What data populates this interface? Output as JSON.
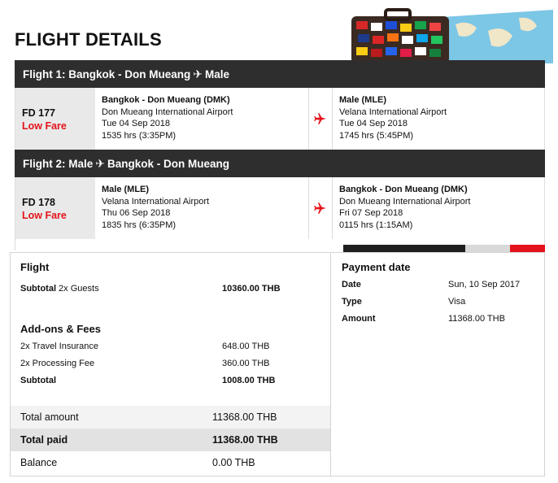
{
  "page": {
    "title": "FLIGHT DETAILS"
  },
  "flights": [
    {
      "header": {
        "from": "Flight 1: Bangkok - Don Mueang",
        "to": "Male"
      },
      "flight_no": "FD 177",
      "fare": "Low Fare",
      "departure": {
        "city": "Bangkok - Don Mueang (DMK)",
        "airport": "Don Mueang International Airport",
        "date": "Tue 04 Sep 2018",
        "time": "1535 hrs (3:35PM)"
      },
      "arrival": {
        "city": "Male (MLE)",
        "airport": "Velana International Airport",
        "date": "Tue 04 Sep 2018",
        "time": "1745 hrs (5:45PM)"
      }
    },
    {
      "header": {
        "from": "Flight 2: Male",
        "to": "Bangkok - Don Mueang"
      },
      "flight_no": "FD 178",
      "fare": "Low Fare",
      "departure": {
        "city": "Male (MLE)",
        "airport": "Velana International Airport",
        "date": "Thu 06 Sep 2018",
        "time": "1835 hrs (6:35PM)"
      },
      "arrival": {
        "city": "Bangkok - Don Mueang (DMK)",
        "airport": "Don Mueang International Airport",
        "date": "Fri 07 Sep 2018",
        "time": "0115 hrs (1:15AM)"
      }
    }
  ],
  "summary": {
    "flight_title": "Flight",
    "subtotal_label_bold": "Subtotal",
    "subtotal_label_rest": " 2x Guests",
    "subtotal_value": "10360.00 THB",
    "addons_title": "Add-ons & Fees",
    "insurance_label": "2x Travel Insurance",
    "insurance_value": "648.00 THB",
    "processing_label": "2x Processing Fee",
    "processing_value": "360.00 THB",
    "addons_subtotal_label": "Subtotal",
    "addons_subtotal_value": "1008.00 THB",
    "total_amount_label": "Total amount",
    "total_amount_value": "11368.00 THB",
    "total_paid_label": "Total paid",
    "total_paid_value": "11368.00 THB",
    "balance_label": "Balance",
    "balance_value": "0.00 THB"
  },
  "payment": {
    "title": "Payment date",
    "date_label": "Date",
    "date_value": "Sun, 10 Sep 2017",
    "type_label": "Type",
    "type_value": "Visa",
    "amount_label": "Amount",
    "amount_value": "11368.00 THB"
  },
  "colors": {
    "accent_red": "#e4131b",
    "header_bg": "#2e2e2e"
  }
}
